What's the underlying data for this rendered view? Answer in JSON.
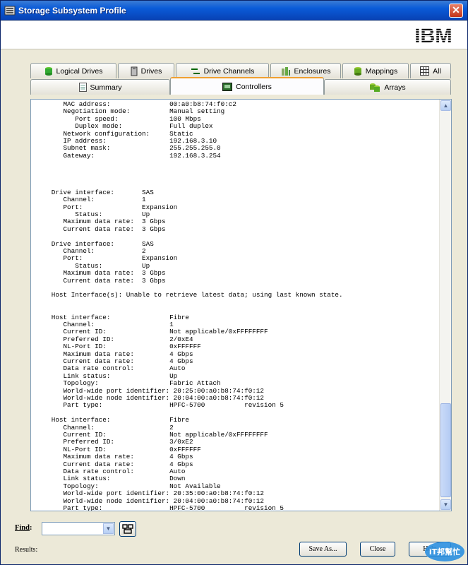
{
  "window": {
    "title": "Storage Subsystem Profile",
    "close_glyph": "✕"
  },
  "brand": {
    "logo_text": "IBM"
  },
  "tabs_row1": [
    {
      "label": "Logical Drives",
      "icon": "cylinder-icon"
    },
    {
      "label": "Drives",
      "icon": "drive-icon"
    },
    {
      "label": "Drive Channels",
      "icon": "channel-icon"
    },
    {
      "label": "Enclosures",
      "icon": "enclosure-icon"
    },
    {
      "label": "Mappings",
      "icon": "mapping-icon"
    },
    {
      "label": "All",
      "icon": "grid-icon"
    }
  ],
  "tabs_row2": [
    {
      "label": "Summary",
      "icon": "document-icon"
    },
    {
      "label": "Controllers",
      "icon": "controller-icon",
      "active": true
    },
    {
      "label": "Arrays",
      "icon": "arrays-icon"
    }
  ],
  "profile_lines": [
    "      MAC address:               00:a0:b8:74:f0:c2",
    "      Negotiation mode:          Manual setting",
    "         Port speed:             100 Mbps",
    "         Duplex mode:            Full duplex",
    "      Network configuration:     Static",
    "      IP address:                192.168.3.10",
    "      Subnet mask:               255.255.255.0",
    "      Gateway:                   192.168.3.254",
    "",
    "",
    "",
    "",
    "   Drive interface:       SAS",
    "      Channel:            1",
    "      Port:               Expansion",
    "         Status:          Up",
    "      Maximum data rate:  3 Gbps",
    "      Current data rate:  3 Gbps",
    "",
    "   Drive interface:       SAS",
    "      Channel:            2",
    "      Port:               Expansion",
    "         Status:          Up",
    "      Maximum data rate:  3 Gbps",
    "      Current data rate:  3 Gbps",
    "",
    "   Host Interface(s): Unable to retrieve latest data; using last known state.",
    "",
    "",
    "   Host interface:               Fibre",
    "      Channel:                   1",
    "      Current ID:                Not applicable/0xFFFFFFFF",
    "      Preferred ID:              2/0xE4",
    "      NL-Port ID:                0xFFFFFF",
    "      Maximum data rate:         4 Gbps",
    "      Current data rate:         4 Gbps",
    "      Data rate control:         Auto",
    "      Link status:               Up",
    "      Topology:                  Fabric Attach",
    "      World-wide port identifier: 20:25:00:a0:b8:74:f0:12",
    "      World-wide node identifier: 20:04:00:a0:b8:74:f0:12",
    "      Part type:                 HPFC-5700          revision 5",
    "",
    "   Host interface:               Fibre",
    "      Channel:                   2",
    "      Current ID:                Not applicable/0xFFFFFFFF",
    "      Preferred ID:              3/0xE2",
    "      NL-Port ID:                0xFFFFFF",
    "      Maximum data rate:         4 Gbps",
    "      Current data rate:         4 Gbps",
    "      Data rate control:         Auto",
    "      Link status:               Down",
    "      Topology:                  Not Available",
    "      World-wide port identifier: 20:35:00:a0:b8:74:f0:12",
    "      World-wide node identifier: 20:04:00:a0:b8:74:f0:12",
    "      Part type:                 HPFC-5700          revision 5"
  ],
  "scrollbar": {
    "position": 0.88
  },
  "find": {
    "label": "Find",
    "colon": ":",
    "value": ""
  },
  "results": {
    "label": "Results:"
  },
  "buttons": {
    "save_as": "Save As...",
    "close": "Close",
    "help": "Help"
  },
  "watermark": {
    "text": "iT邦幫忙"
  },
  "colors": {
    "titlebar": "#0a5bd8",
    "active_tab_accent": "#f0a030",
    "window_bg": "#ece9d8"
  }
}
